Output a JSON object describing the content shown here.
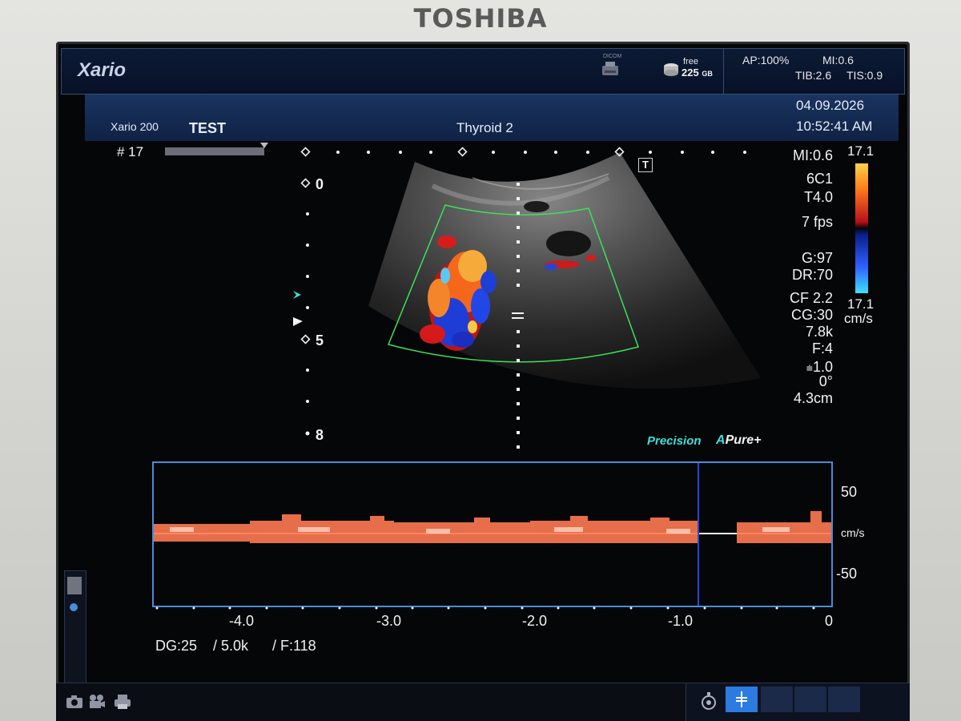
{
  "device": {
    "brand": "TOSHIBA",
    "logo": "Xario"
  },
  "topbar": {
    "dicom_label": "DICOM",
    "free_label": "free",
    "free_value": "225",
    "free_unit": "GB",
    "ap": "AP:100%",
    "mi": "MI:0.6",
    "tib": "TIB:2.6",
    "tis": "TIS:0.9"
  },
  "header": {
    "model": "Xario 200",
    "patient": "TEST",
    "preset": "Thyroid 2",
    "date": "04.09.2026",
    "time": "10:52:41 AM"
  },
  "image": {
    "frame": "# 17",
    "depth_ticks": [
      "0",
      "5",
      "8"
    ],
    "t_marker": "T"
  },
  "params": {
    "mi": "MI:0.6",
    "probe": "6C1",
    "t": "T4.0",
    "fps": "7 fps",
    "gain": "G:97",
    "dr": "DR:70",
    "cf": "CF 2.2",
    "cg": "CG:30",
    "prf": "7.8k",
    "filter": "F:4",
    "steer": "1.0",
    "angle": "0°",
    "depth": "4.3cm"
  },
  "colorbar": {
    "top": "17.1",
    "bottom": "17.1",
    "unit": "cm/s",
    "top_color": "#ffd24a",
    "bottom_color": "#3ee0ff"
  },
  "modes": {
    "precision": "Precision",
    "apure_a": "A",
    "apure": "Pure",
    "apure_plus": "+"
  },
  "doppler": {
    "vel_top": "50",
    "vel_unit": "cm/s",
    "vel_bottom": "-50",
    "time_labels": [
      "-4.0",
      "-3.0",
      "-2.0",
      "-1.0",
      "0"
    ],
    "dg": "DG:25",
    "prf": "/ 5.0k",
    "filter": "/ F:118"
  },
  "colors": {
    "accent": "#4a8cd8",
    "roi": "#3de05a",
    "header_bg": "#16305a"
  }
}
